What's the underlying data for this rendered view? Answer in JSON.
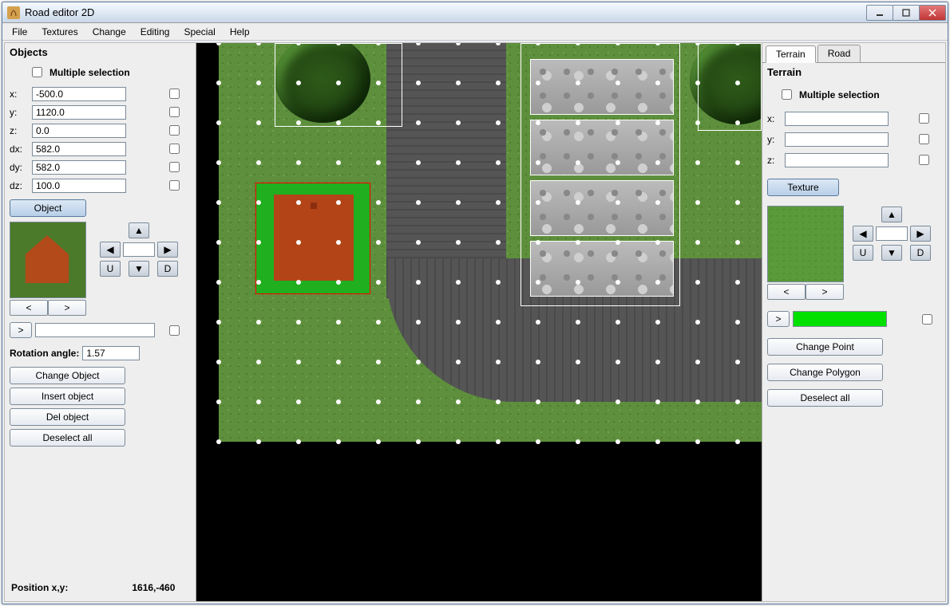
{
  "window": {
    "title": "Road editor 2D"
  },
  "menu": [
    "File",
    "Textures",
    "Change",
    "Editing",
    "Special",
    "Help"
  ],
  "left": {
    "title": "Objects",
    "multiple_selection": "Multiple selection",
    "fields": {
      "x": {
        "label": "x:",
        "value": "-500.0"
      },
      "y": {
        "label": "y:",
        "value": "1120.0"
      },
      "z": {
        "label": "z:",
        "value": "0.0"
      },
      "dx": {
        "label": "dx:",
        "value": "582.0"
      },
      "dy": {
        "label": "dy:",
        "value": "582.0"
      },
      "dz": {
        "label": "dz:",
        "value": "100.0"
      }
    },
    "object_btn": "Object",
    "prev": "<",
    "next": ">",
    "expand": ">",
    "rotation_label": "Rotation angle:",
    "rotation_value": "1.57",
    "buttons": [
      "Change Object",
      "Insert object",
      "Del object",
      "Deselect all"
    ],
    "arrow_center": ""
  },
  "arrows": {
    "up": "▲",
    "down": "▼",
    "left": "◀",
    "right": "▶",
    "U": "U",
    "D": "D"
  },
  "status": {
    "label": "Position x,y:",
    "value": "1616,-460"
  },
  "right": {
    "tabs": [
      "Terrain",
      "Road"
    ],
    "active_tab": 0,
    "title": "Terrain",
    "multiple_selection": "Multiple selection",
    "fields": {
      "x": {
        "label": "x:",
        "value": ""
      },
      "y": {
        "label": "y:",
        "value": ""
      },
      "z": {
        "label": "z:",
        "value": ""
      }
    },
    "texture_btn": "Texture",
    "prev": "<",
    "next": ">",
    "expand": ">",
    "buttons": [
      "Change Point",
      "Change Polygon",
      "Deselect all"
    ],
    "arrow_center": ""
  }
}
